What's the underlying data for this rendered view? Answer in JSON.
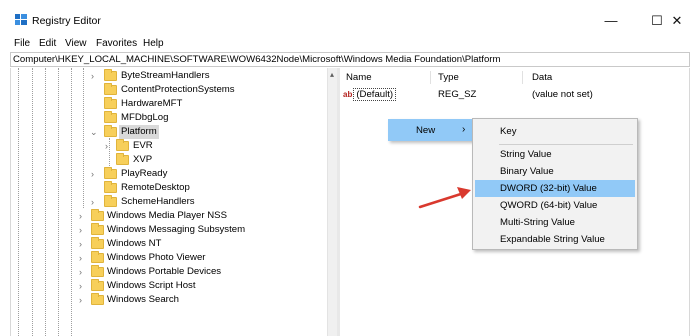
{
  "window": {
    "title": "Registry Editor",
    "buttons": {
      "minimize": "—",
      "maximize": "☐",
      "close": "✕"
    }
  },
  "menubar": [
    "File",
    "Edit",
    "View",
    "Favorites",
    "Help"
  ],
  "address": "Computer\\HKEY_LOCAL_MACHINE\\SOFTWARE\\WOW6432Node\\Microsoft\\Windows Media Foundation\\Platform",
  "tree": {
    "items": [
      {
        "label": "ByteStreamHandlers",
        "expander": "›"
      },
      {
        "label": "ContentProtectionSystems",
        "expander": ""
      },
      {
        "label": "HardwareMFT",
        "expander": ""
      },
      {
        "label": "MFDbgLog",
        "expander": ""
      },
      {
        "label": "Platform",
        "expander": "⌄",
        "selected": true
      },
      {
        "label": "EVR",
        "expander": "›"
      },
      {
        "label": "XVP",
        "expander": ""
      },
      {
        "label": "PlayReady",
        "expander": "›"
      },
      {
        "label": "RemoteDesktop",
        "expander": ""
      },
      {
        "label": "SchemeHandlers",
        "expander": "›"
      },
      {
        "label": "Windows Media Player NSS",
        "expander": "›"
      },
      {
        "label": "Windows Messaging Subsystem",
        "expander": "›"
      },
      {
        "label": "Windows NT",
        "expander": "›"
      },
      {
        "label": "Windows Photo Viewer",
        "expander": "›"
      },
      {
        "label": "Windows Portable Devices",
        "expander": "›"
      },
      {
        "label": "Windows Script Host",
        "expander": "›"
      },
      {
        "label": "Windows Search",
        "expander": "›"
      }
    ],
    "scroll_arrow": "▴"
  },
  "values": {
    "columns": {
      "name": "Name",
      "type": "Type",
      "data": "Data"
    },
    "rows": [
      {
        "icon": "ab",
        "name": "(Default)",
        "type": "REG_SZ",
        "data": "(value not set)"
      }
    ]
  },
  "context_menu": {
    "new_label": "New",
    "new_arrow": "›",
    "submenu": [
      "Key",
      "String Value",
      "Binary Value",
      "DWORD (32-bit) Value",
      "QWORD (64-bit) Value",
      "Multi-String Value",
      "Expandable String Value"
    ],
    "highlighted": "DWORD (32-bit) Value"
  },
  "colors": {
    "highlight": "#91c9f7",
    "annotation_arrow": "#d9392e",
    "folder": "#f7cf5a"
  }
}
